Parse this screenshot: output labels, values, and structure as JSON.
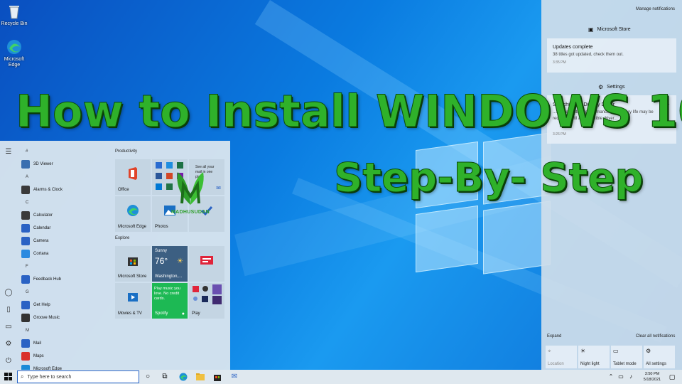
{
  "desktop_icons": [
    {
      "label": "Recycle Bin",
      "icon": "recycle-bin-icon"
    },
    {
      "label": "Microsoft Edge",
      "icon": "edge-icon"
    }
  ],
  "overlay": {
    "line1": "How to Install WINDOWS 10",
    "line2": "Step-By- Step",
    "watermark": "MADHUSUDAN",
    "color": "#2fb12a"
  },
  "start_menu": {
    "list": [
      {
        "type": "letter",
        "text": "#"
      },
      {
        "type": "app",
        "text": "3D Viewer",
        "color": "#3a6fb0"
      },
      {
        "type": "letter",
        "text": "A"
      },
      {
        "type": "app",
        "text": "Alarms & Clock",
        "color": "#3a3a3a"
      },
      {
        "type": "letter",
        "text": "C"
      },
      {
        "type": "app",
        "text": "Calculator",
        "color": "#3a3a3a"
      },
      {
        "type": "app",
        "text": "Calendar",
        "color": "#2a62c4"
      },
      {
        "type": "app",
        "text": "Camera",
        "color": "#2a62c4"
      },
      {
        "type": "app",
        "text": "Cortana",
        "color": "#2a8ae0"
      },
      {
        "type": "letter",
        "text": "F"
      },
      {
        "type": "app",
        "text": "Feedback Hub",
        "color": "#2a62c4"
      },
      {
        "type": "letter",
        "text": "G"
      },
      {
        "type": "app",
        "text": "Get Help",
        "color": "#2a62c4"
      },
      {
        "type": "app",
        "text": "Groove Music",
        "color": "#333333"
      },
      {
        "type": "letter",
        "text": "M"
      },
      {
        "type": "app",
        "text": "Mail",
        "color": "#2a62c4"
      },
      {
        "type": "app",
        "text": "Maps",
        "color": "#d9302c"
      },
      {
        "type": "app",
        "text": "Microsoft Edge",
        "color": "#1a8ad8"
      }
    ],
    "groups": {
      "productivity": "Productivity",
      "explore": "Explore"
    },
    "tiles": {
      "office": "Office",
      "see_all": "See all your mail in one place",
      "edge": "Microsoft Edge",
      "photos": "Photos",
      "store": "Microsoft Store",
      "weather_city": "Sunny",
      "weather_temp": "76°",
      "weather_loc": "Washington,...",
      "movies": "Movies & TV",
      "spotify_text": "Play music you love. No credit cards.",
      "spotify": "Spotify",
      "play": "Play"
    }
  },
  "action_center": {
    "manage": "Manage notifications",
    "store_app": "Microsoft Store",
    "store_title": "Updates complete",
    "store_body": "38 titles got updated, check them out.",
    "store_time": "3:35 PM",
    "settings_app": "Settings",
    "settings_title": "Searching for Display Driver",
    "settings_body": "...tion resolution, performance and battery life may be reduced until a compatible driver...",
    "settings_time": "3:26 PM",
    "expand": "Expand",
    "clear": "Clear all notifications",
    "quick_actions": [
      "Location",
      "Night light",
      "Tablet mode",
      "All settings"
    ]
  },
  "taskbar": {
    "search_placeholder": "Type here to search",
    "time": "3:50 PM",
    "date": "5/18/2021"
  }
}
